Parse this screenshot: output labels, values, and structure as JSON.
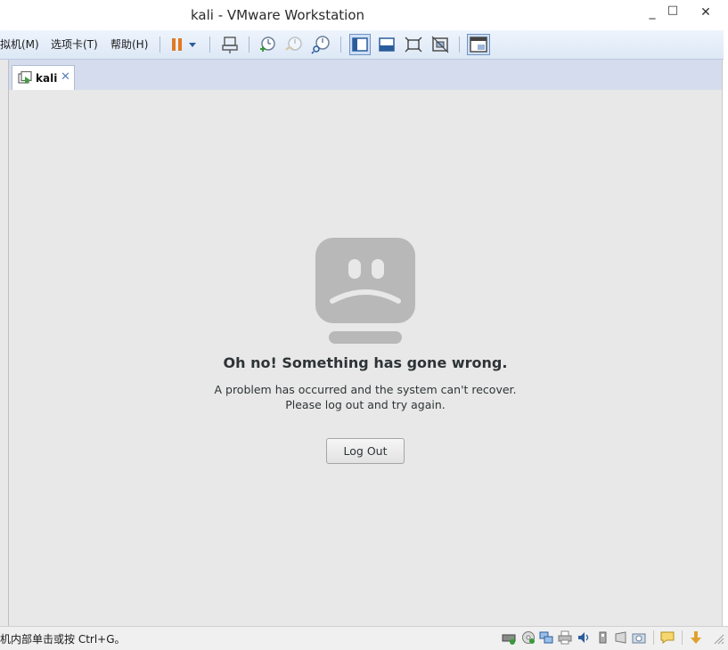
{
  "window": {
    "title": "kali - VMware Workstation",
    "minimize_glyph": "_",
    "maximize_glyph": "□",
    "close_glyph": "✕"
  },
  "menu": {
    "items": [
      "拟机(M)",
      "选项卡(T)",
      "帮助(H)"
    ]
  },
  "toolbar": {
    "icons": [
      "pause-icon",
      "dropdown-arrow-icon",
      "send-ctrl-alt-del-icon",
      "snapshot-take-icon",
      "snapshot-revert-icon",
      "snapshot-manager-icon",
      "console-view-icon",
      "quick-switch-icon",
      "fullscreen-icon",
      "unity-icon",
      "thumbnail-view-icon"
    ],
    "pause_color": "#e07a22",
    "accent": "#2b5d9c"
  },
  "tabs": [
    {
      "label": "kali",
      "close_glyph": "✕"
    }
  ],
  "vm": {
    "error_title": "Oh no!  Something has gone wrong.",
    "error_line1": "A problem has occurred and the system can't recover.",
    "error_line2": "Please log out and try again.",
    "logout_label": "Log Out",
    "face_color": "#b8b8b8",
    "background": "#e8e8e8"
  },
  "statusbar": {
    "text": "机内部单击或按 Ctrl+G。",
    "icons": [
      "hard-disk-icon",
      "cd-dvd-icon",
      "network-adapter-icon",
      "printer-icon",
      "sound-card-icon",
      "usb-icon",
      "display-icon",
      "camera-icon",
      "message-icon",
      "download-icon"
    ]
  }
}
